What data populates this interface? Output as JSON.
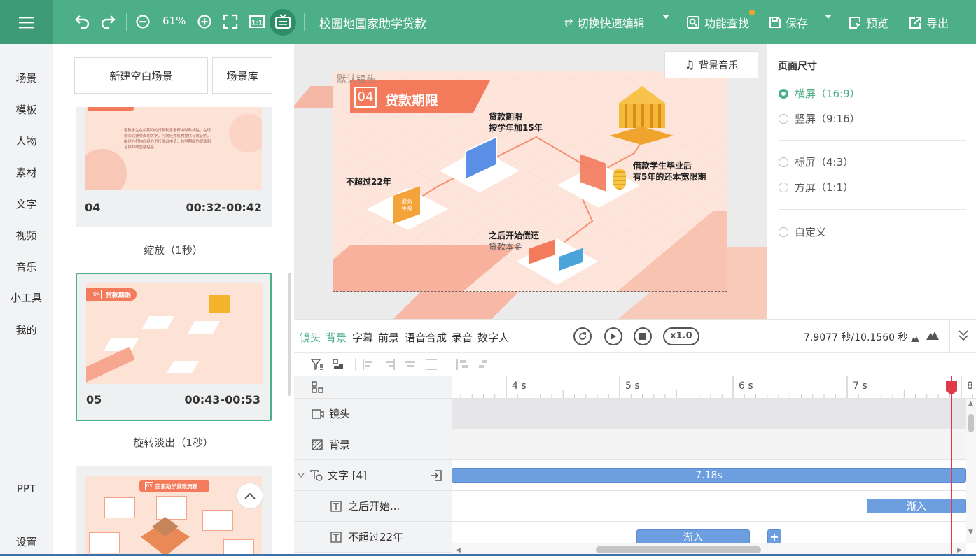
{
  "app": {
    "title": "校园地国家助学贷款",
    "zoom": "61%"
  },
  "topbar": {
    "quick_edit": "切换快速编辑",
    "feature_search": "功能查找",
    "save": "保存",
    "preview": "预览",
    "export": "导出"
  },
  "leftnav": [
    "场景",
    "模板",
    "人物",
    "素材",
    "文字",
    "视频",
    "音乐",
    "小工具",
    "我的"
  ],
  "leftnav_bottom": {
    "ppt": "PPT",
    "settings": "设置"
  },
  "scene_panel": {
    "new_blank": "新建空白场景",
    "library": "场景库",
    "scenes": [
      {
        "num": "04",
        "time": "00:32-00:42",
        "transition": "缩放（1秒）",
        "thumb_text": "倡教学生在校期间的贷款利息全部由财政补贴，在读期间需要等面期休学，可向经办机构提供有效证明。由经办机构向经办进行提出申请，休学期间的贷款利息由财政全额贴息。"
      },
      {
        "num": "05",
        "time": "00:43-00:53",
        "transition": "旋转淡出（1秒）",
        "thumb_title": "贷款期限",
        "thumb_badge": "04"
      },
      {
        "thumb_title": "国家助学贷款流程",
        "thumb_badge": "05"
      }
    ]
  },
  "canvas": {
    "bg_music": "背景音乐",
    "camera_label": "默认镜头",
    "slide": {
      "badge": "04",
      "title": "贷款期限",
      "label_term_1": "贷款期限",
      "label_term_2": "按学年加15年",
      "label_max": "不超过22年",
      "label_grace_1": "借款学生毕业后",
      "label_grace_2": "有5年的还本宽限期",
      "label_repay_1": "之后开始偿还",
      "label_repay_2": "贷款本金",
      "card_text_1": "最高",
      "card_text_2": "年限"
    }
  },
  "right_panel": {
    "title": "页面尺寸",
    "options": [
      "横屏（16:9）",
      "竖屏（9:16）",
      "标屏（4:3）",
      "方屏（1:1）",
      "自定义"
    ],
    "selected": "横屏（16:9）"
  },
  "timeline": {
    "tabs": [
      "镜头",
      "背景",
      "字幕",
      "前景",
      "语音合成",
      "录音",
      "数字人"
    ],
    "active_tabs": [
      "镜头",
      "背景"
    ],
    "speed": "x1.0",
    "time": "7.9077 秒/10.1560 秒",
    "ticks": [
      "4 s",
      "5 s",
      "6 s",
      "7 s",
      "8"
    ],
    "rows": {
      "camera": "镜头",
      "background": "背景",
      "text_group": "文字 [4]",
      "text_1": "之后开始...",
      "text_2": "不超过22年"
    },
    "bars": {
      "group_duration": "7.18s",
      "fade_in": "渐入",
      "add": "+"
    }
  },
  "colors": {
    "accent": "#4daf88",
    "accent_dark": "#3f9a77",
    "bar": "#6d9fe0",
    "playhead": "#e0394a",
    "slide_orange": "#f37a5b"
  }
}
